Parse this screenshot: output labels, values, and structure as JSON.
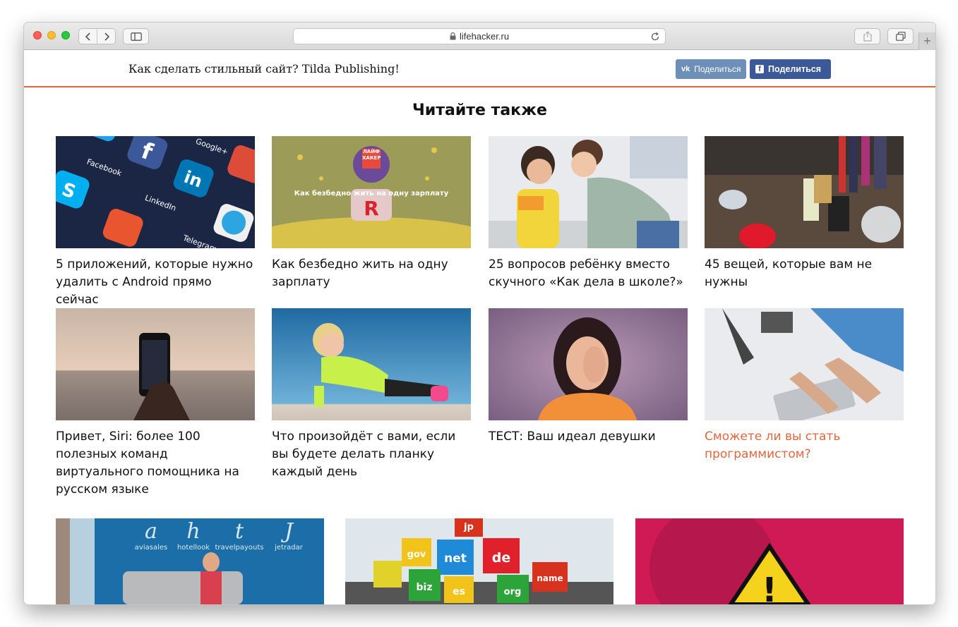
{
  "browser": {
    "url": "lifehacker.ru",
    "plus_label": "+"
  },
  "sharebar": {
    "title": "Как сделать стильный сайт? Tilda Publishing!",
    "vk_label": "Поделиться",
    "fb_label": "Поделиться"
  },
  "section": {
    "heading": "Читайте также"
  },
  "articles": [
    {
      "title": "5 приложений, которые нужно удалить с Android прямо сейчас",
      "highlighted": false
    },
    {
      "title": "Как безбедно жить на одну зарплату",
      "image_caption": "Как безбедно жить на одну зарплату",
      "image_badge": "ЛАЙФ ХАКЕР",
      "highlighted": false
    },
    {
      "title": "25 вопросов ребёнку вместо скучного «Как дела в школе?»",
      "highlighted": false
    },
    {
      "title": "45 вещей, которые вам не нужны",
      "highlighted": false
    },
    {
      "title": "Привет, Siri: более 100 полезных команд виртуального помощника на русском языке",
      "highlighted": false
    },
    {
      "title": "Что произойдёт с вами, если вы будете делать планку каждый день",
      "highlighted": false
    },
    {
      "title": "ТЕСТ: Ваш идеал девушки",
      "highlighted": false
    },
    {
      "title": "Сможете ли вы стать программистом?",
      "highlighted": true
    }
  ],
  "bottom_images": [
    {
      "labels": [
        "a",
        "h",
        "t",
        "J"
      ],
      "sublabels": [
        "aviasales",
        "hotellook",
        "travelpayouts",
        "jetradar"
      ]
    },
    {
      "cubes": [
        "jp",
        "gov",
        "net",
        "de",
        "biz",
        "es",
        "org",
        "name"
      ]
    },
    {
      "sign": "!"
    }
  ],
  "colors": {
    "accent": "#e1663d",
    "vk": "#6e8fb7",
    "facebook": "#3b5998"
  },
  "icons": [
    "back-icon",
    "forward-icon",
    "sidebar-icon",
    "lock-icon",
    "reload-icon",
    "share-icon",
    "tabs-icon",
    "vk-icon",
    "facebook-icon"
  ]
}
